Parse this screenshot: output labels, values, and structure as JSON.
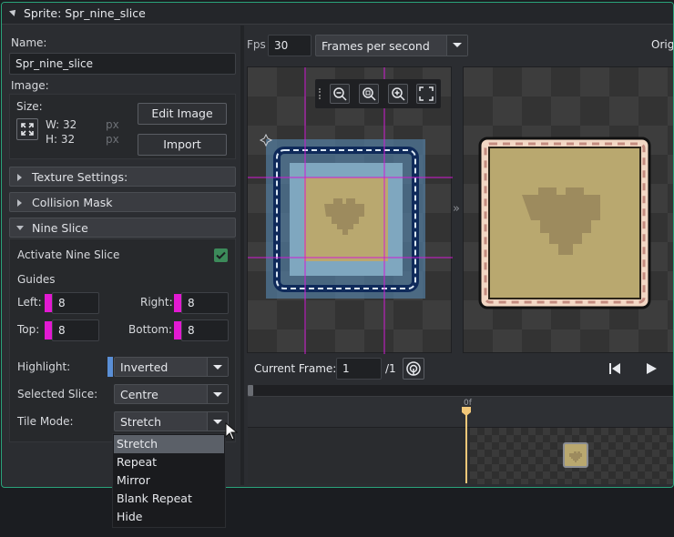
{
  "window": {
    "title": "Sprite: Spr_nine_slice"
  },
  "name": {
    "label": "Name:",
    "value": "Spr_nine_slice"
  },
  "image": {
    "label": "Image:",
    "size_label": "Size:",
    "width": "W: 32",
    "height": "H: 32",
    "unit_w": "px",
    "unit_h": "px",
    "edit_button": "Edit Image",
    "import_button": "Import"
  },
  "sections": {
    "texture": "Texture Settings:",
    "collision": "Collision Mask",
    "nine_slice": "Nine Slice"
  },
  "nine_slice": {
    "activate_label": "Activate Nine Slice",
    "activate_checked": true,
    "guides_label": "Guides",
    "left_label": "Left:",
    "left_value": "8",
    "right_label": "Right:",
    "right_value": "8",
    "top_label": "Top:",
    "top_value": "8",
    "bottom_label": "Bottom:",
    "bottom_value": "8",
    "highlight_label": "Highlight:",
    "highlight_value": "Inverted",
    "selected_slice_label": "Selected Slice:",
    "selected_slice_value": "Centre",
    "tile_mode_label": "Tile Mode:",
    "tile_mode_value": "Stretch",
    "tile_mode_options": [
      "Stretch",
      "Repeat",
      "Mirror",
      "Blank Repeat",
      "Hide"
    ],
    "guide_color": "#e21ad2"
  },
  "toolbar": {
    "fps_label": "Fps",
    "fps_value": "30",
    "speed_mode": "Frames per second",
    "origin_label": "Origi"
  },
  "playback": {
    "current_frame_label": "Current Frame:",
    "current_frame_value": "1",
    "total_frames": "/1"
  },
  "timeline": {
    "marker_label": "0f"
  },
  "colors": {
    "accent": "#2aa37a",
    "checkbox": "#3c8a5a",
    "menu_selected": "#5b6068",
    "timeline_marker": "#f2c879"
  }
}
